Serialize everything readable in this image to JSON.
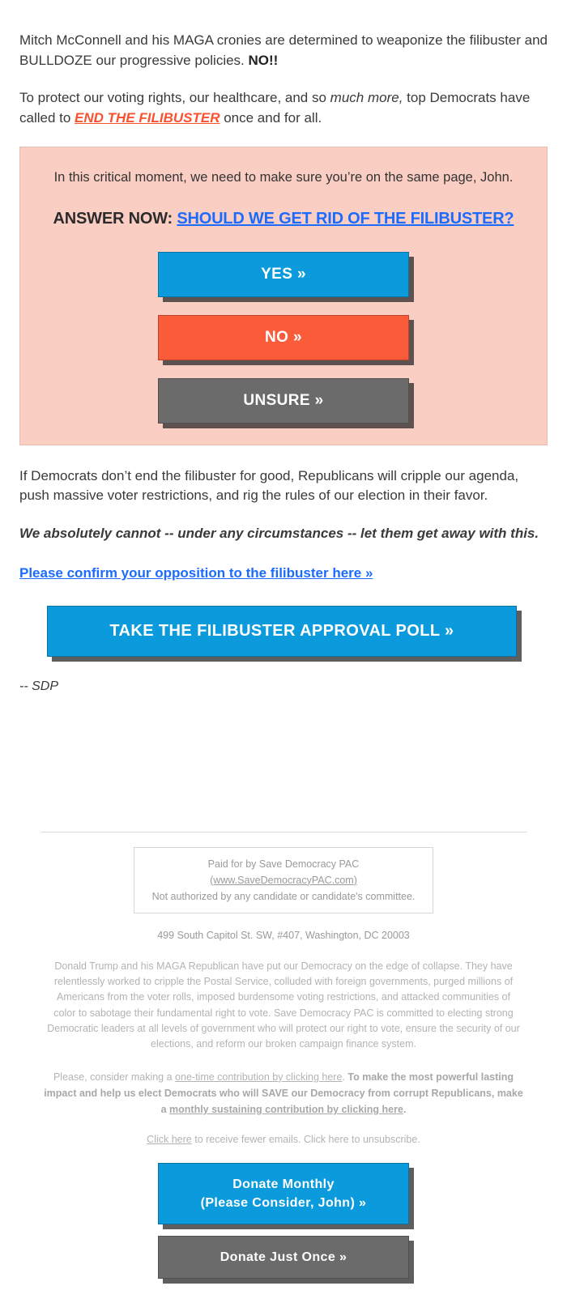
{
  "intro": {
    "para1_a": "Mitch McConnell and his MAGA cronies are determined to weaponize the filibuster and BULLDOZE our progressive policies. ",
    "para1_bold": "NO!!",
    "para2_a": "To protect our voting rights, our healthcare, and so ",
    "para2_ital": "much more,",
    "para2_b": " top Democrats have called to ",
    "para2_link": "END THE FILIBUSTER",
    "para2_c": " once and for all."
  },
  "callout": {
    "lead": "In this critical moment, we need to make sure you’re on the same page, John.",
    "question_prefix": "ANSWER NOW: ",
    "question_link": "SHOULD WE GET RID OF THE FILIBUSTER?",
    "buttons": [
      {
        "label": "YES »",
        "color": "#0B9BDD",
        "style": "blue"
      },
      {
        "label": "NO »",
        "color": "#FA5B38",
        "style": "orange"
      },
      {
        "label": "UNSURE »",
        "color": "#6B6B6B",
        "style": "gray"
      }
    ]
  },
  "middle": {
    "para3": "If Democrats don’t end the filibuster for good, Republicans will cripple our agenda, push massive voter restrictions, and rig the rules of our election in their favor.",
    "para4_bold_ital": "We absolutely cannot -- under any circumstances -- let them get away with this.",
    "confirm_link": "Please confirm your opposition to the filibuster here »",
    "cta_label": "TAKE THE FILIBUSTER APPROVAL POLL »",
    "signature": "-- SDP"
  },
  "footer": {
    "paid_for": "Paid for by Save Democracy PAC",
    "website": "(www.SaveDemocracyPAC.com)",
    "not_authorized": "Not authorized by any candidate or candidate's committee.",
    "address": "499 South Capitol St. SW, #407, Washington, DC 20003",
    "disclaimer": "Donald Trump and his MAGA Republican have put our Democracy on the edge of collapse. They have relentlessly worked to cripple the Postal Service, colluded with foreign governments, purged millions of Americans from the voter rolls, imposed burdensome voting restrictions, and attacked communities of color to sabotage their fundamental right to vote. Save Democracy PAC is committed to electing strong Democratic leaders at all levels of government who will protect our right to vote, ensure the security of our elections, and reform our broken campaign finance system.",
    "ask_a": "Please, consider making a ",
    "ask_link1": "one-time contribution by clicking here",
    "ask_b": ". ",
    "ask_strong_a": "To make the most powerful lasting impact and help us elect Democrats who will SAVE our Democracy from corrupt Republicans, make a ",
    "ask_link2": "monthly sustaining contribution by clicking here",
    "ask_strong_b": ".",
    "unsub_link": "Click here",
    "unsub_text": " to receive fewer emails. Click here to unsubscribe.",
    "donate_monthly_line1": "Donate Monthly",
    "donate_monthly_line2": "(Please Consider, John) »",
    "donate_once": "Donate Just Once »"
  },
  "colors": {
    "blue": "#0B9BDD",
    "orange": "#FA5B38",
    "gray": "#6B6B6B",
    "pink_bg": "#FBCEC3",
    "link_blue": "#1C6BFF",
    "link_red": "#FA5230"
  }
}
